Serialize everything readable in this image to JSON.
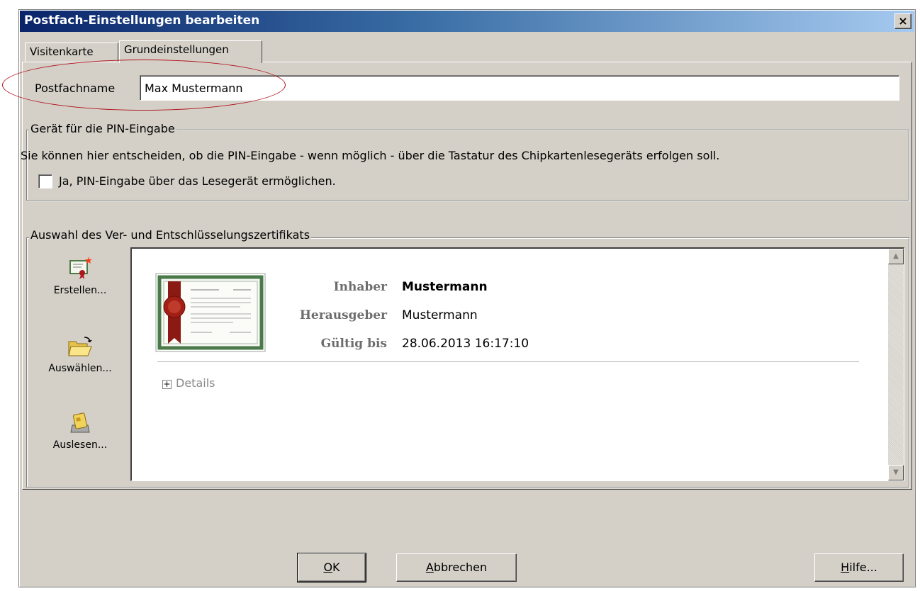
{
  "window": {
    "title": "Postfach-Einstellungen bearbeiten",
    "close_label": "×"
  },
  "tabs": [
    {
      "label": "Visitenkarte",
      "active": false
    },
    {
      "label": "Grundeinstellungen",
      "active": true
    }
  ],
  "mailbox": {
    "label": "Postfachname",
    "value": "Max Mustermann"
  },
  "pin_device": {
    "legend": "Gerät für die PIN-Eingabe",
    "description": "Sie können hier entscheiden, ob die PIN-Eingabe - wenn möglich - über die Tastatur des Chipkartenlesegeräts erfolgen soll.",
    "checkbox_label": "Ja, PIN-Eingabe über das Lesegerät ermöglichen.",
    "checked": false
  },
  "certificate": {
    "legend": "Auswahl des Ver- und Entschlüsselungszertifikats",
    "actions": [
      {
        "label": "Erstellen...",
        "icon": "certificate-new-icon"
      },
      {
        "label": "Auswählen...",
        "icon": "folder-open-icon"
      },
      {
        "label": "Auslesen...",
        "icon": "card-reader-icon"
      }
    ],
    "fields": {
      "owner_label": "Inhaber",
      "owner_value": "Mustermann",
      "issuer_label": "Herausgeber",
      "issuer_value": "Mustermann",
      "valid_label": "Gültig bis",
      "valid_value": "28.06.2013 16:17:10"
    },
    "details_label": "Details"
  },
  "buttons": {
    "ok_mn": "O",
    "ok_rest": "K",
    "cancel_mn": "A",
    "cancel_rest": "bbrechen",
    "help_mn": "H",
    "help_rest": "ilfe..."
  },
  "colors": {
    "titlebar_start": "#0a246a",
    "titlebar_end": "#a6caf0",
    "dialog_bg": "#d4d0c8",
    "highlight_ellipse": "#b0141c"
  }
}
